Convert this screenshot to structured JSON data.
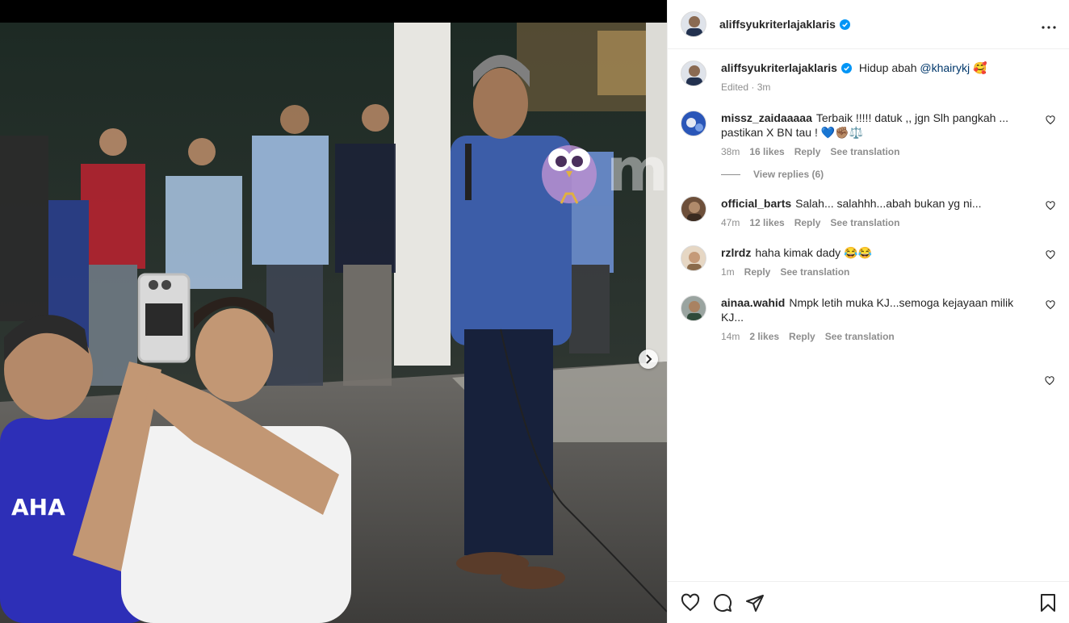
{
  "post": {
    "username": "aliffsyukriterlajaklaris",
    "watermark": "murai"
  },
  "caption": {
    "username": "aliffsyukriterlajaklaris",
    "text": "Hidup abah",
    "mention": "@khairykj",
    "emoji": "🥰",
    "meta": "Edited · 3m"
  },
  "comments": [
    {
      "username": "missz_zaidaaaaa",
      "text": "Terbaik !!!!! datuk ,, jgn Slh pangkah ... pastikan X BN tau ! 💙✊🏽⚖️",
      "time": "38m",
      "likes": "16 likes",
      "reply": "Reply",
      "translate": "See translation",
      "view_replies": "View replies (6)"
    },
    {
      "username": "official_barts",
      "text": "Salah... salahhh...abah bukan yg ni...",
      "time": "47m",
      "likes": "12 likes",
      "reply": "Reply",
      "translate": "See translation"
    },
    {
      "username": "rzlrdz",
      "text": "haha kimak dady 😂😂",
      "time": "1m",
      "reply": "Reply",
      "translate": "See translation"
    },
    {
      "username": "ainaa.wahid",
      "text": "Nmpk letih muka KJ...semoga kejayaan milik KJ...",
      "time": "14m",
      "likes": "2 likes",
      "reply": "Reply",
      "translate": "See translation"
    }
  ],
  "icons": {
    "verified": "verified-badge-icon",
    "more": "more-options-icon",
    "like": "heart-icon",
    "comment": "comment-icon",
    "share": "share-icon",
    "save": "bookmark-icon",
    "next": "chevron-right-icon"
  },
  "colors": {
    "verified": "#0095f6",
    "muted": "#8e8e8e",
    "text": "#262626",
    "mention": "#00376b"
  }
}
